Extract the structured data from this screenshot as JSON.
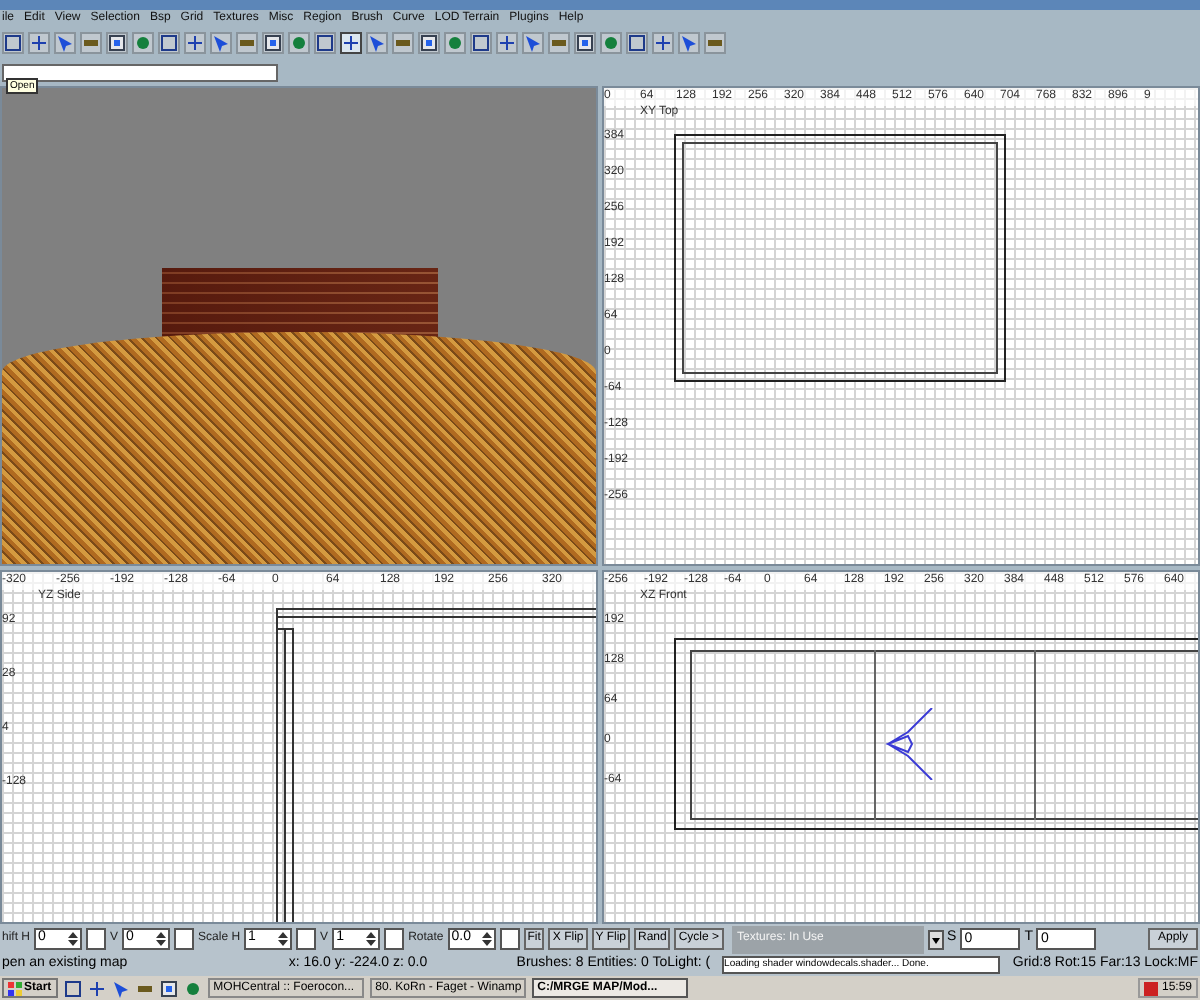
{
  "menu": [
    "ile",
    "Edit",
    "View",
    "Selection",
    "Bsp",
    "Grid",
    "Textures",
    "Misc",
    "Region",
    "Brush",
    "Curve",
    "LOD Terrain",
    "Plugins",
    "Help"
  ],
  "toolbar": [
    {
      "selected": false
    },
    {
      "selected": false
    },
    {
      "selected": false
    },
    {
      "selected": false
    },
    {
      "selected": false
    },
    {
      "selected": false
    },
    {
      "selected": false
    },
    {
      "selected": false
    },
    {
      "selected": false
    },
    {
      "selected": false
    },
    {
      "selected": false
    },
    {
      "selected": false
    },
    {
      "selected": false
    },
    {
      "selected": true
    },
    {
      "selected": false
    },
    {
      "selected": false
    },
    {
      "selected": false
    },
    {
      "selected": false
    },
    {
      "selected": false
    },
    {
      "selected": false
    },
    {
      "selected": false
    },
    {
      "selected": false
    },
    {
      "selected": false
    },
    {
      "selected": false
    },
    {
      "selected": false
    },
    {
      "selected": false
    },
    {
      "selected": false
    },
    {
      "selected": false
    }
  ],
  "tooltip": "Open",
  "viewports": [
    {
      "kind": "camera"
    },
    {
      "kind": "grid",
      "title": "XY Top",
      "x_ruler": [
        "0",
        "64",
        "128",
        "192",
        "256",
        "320",
        "384",
        "448",
        "512",
        "576",
        "640",
        "704",
        "768",
        "832",
        "896",
        "9"
      ],
      "y_ruler": [
        "384",
        "320",
        "256",
        "192",
        "128",
        "64",
        "0",
        "-64",
        "-128",
        "-192",
        "-256"
      ]
    },
    {
      "kind": "grid",
      "title": "YZ Side",
      "x_ruler": [
        "-320",
        "-256",
        "-192",
        "-128",
        "-64",
        "0",
        "64",
        "128",
        "192",
        "256",
        "320"
      ],
      "y_ruler": [
        "92",
        "28",
        "4",
        "-128"
      ]
    },
    {
      "kind": "grid",
      "title": "XZ Front",
      "x_ruler": [
        "-256",
        "-192",
        "-128",
        "-64",
        "0",
        "64",
        "128",
        "192",
        "256",
        "320",
        "384",
        "448",
        "512",
        "576",
        "640"
      ],
      "y_ruler": [
        "192",
        "128",
        "64",
        "0",
        "-64"
      ]
    }
  ],
  "surface_fields": [
    {
      "label": "hift H",
      "value": "0"
    },
    {
      "label": "V",
      "value": "0"
    },
    {
      "label": "Scale H",
      "value": "1"
    },
    {
      "label": "V",
      "value": "1"
    },
    {
      "label": "Rotate",
      "value": "0.0"
    }
  ],
  "surface_buttons": [
    "Fit",
    "X Flip",
    "Y Flip",
    "Rand",
    "Cycle >"
  ],
  "texture_window": {
    "title": "Textures: In Use",
    "message": "Loading shader windowdecals.shader... Done."
  },
  "st_fields": [
    {
      "label": "S",
      "value": "0"
    },
    {
      "label": "T",
      "value": "0"
    }
  ],
  "apply": "Apply",
  "status_bar": {
    "message": "pen an existing map",
    "coords": "x:  16.0  y:  -224.0  z:  0.0",
    "counts": "Brushes: 8  Entities: 0  ToLight: (",
    "grid": "Grid:8 Rot:15 Far:13 Lock:MF"
  },
  "taskbar": {
    "start": "Start",
    "tasks": [
      {
        "label": "MOHCentral :: Foerocon...",
        "selected": false
      },
      {
        "label": "80. KoRn - Faget - Winamp",
        "selected": false
      },
      {
        "label": "C:/MRGE MAP/Mod...",
        "selected": true
      }
    ],
    "clock": "15:59"
  }
}
